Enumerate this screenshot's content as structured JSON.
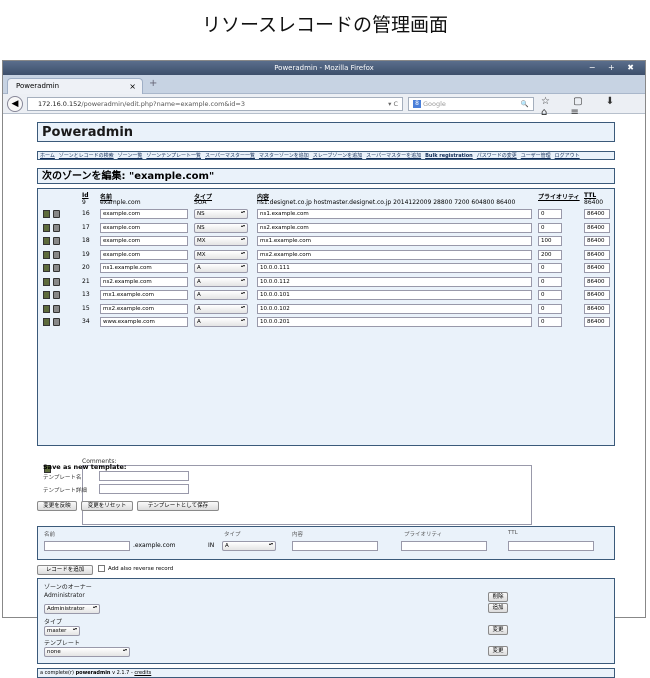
{
  "caption": "リソースレコードの管理画面",
  "window": {
    "title": "Poweradmin - Mozilla Firefox",
    "controls": "− + ✖",
    "tab_label": "Poweradmin",
    "tab_close": "×",
    "new_tab": "+"
  },
  "nav": {
    "url_prefix": "172.16.0.152",
    "url_path": "/poweradmin/edit.php?name=example.com&id=3",
    "url_end": "▾ C",
    "search_placeholder": "Google",
    "icons": "☆ ▢ ⬇ ⌂ ≡"
  },
  "page": {
    "title": "Poweradmin",
    "menu": [
      "ホーム",
      "ゾーンとレコードの検索",
      "ゾーン一覧",
      "ゾーンテンプレート一覧",
      "スーパーマスター一覧",
      "マスターゾーンを追加",
      "スレーブゾーンを追加",
      "スーパーマスターを追加",
      "Bulk registration",
      "パスワードの変更",
      "ユーザー管理",
      "ログアウト"
    ],
    "heading": "次のゾーンを編集: \"example.com\""
  },
  "table": {
    "headers": {
      "id": "Id",
      "name": "名前",
      "type": "タイプ",
      "content": "内容",
      "priority": "プライオリティ",
      "ttl": "TTL"
    },
    "soa": {
      "id": "9",
      "name": "example.com",
      "type": "SOA",
      "content": "ns1.designet.co.jp hostmaster.designet.co.jp 2014122009 28800 7200 604800 86400",
      "ttl": "86400"
    },
    "rows": [
      {
        "id": "16",
        "name": "example.com",
        "type": "NS",
        "content": "ns1.example.com",
        "prio": "0",
        "ttl": "86400"
      },
      {
        "id": "17",
        "name": "example.com",
        "type": "NS",
        "content": "ns2.example.com",
        "prio": "0",
        "ttl": "86400"
      },
      {
        "id": "18",
        "name": "example.com",
        "type": "MX",
        "content": "mx1.example.com",
        "prio": "100",
        "ttl": "86400"
      },
      {
        "id": "19",
        "name": "example.com",
        "type": "MX",
        "content": "mx2.example.com",
        "prio": "200",
        "ttl": "86400"
      },
      {
        "id": "20",
        "name": "ns1.example.com",
        "type": "A",
        "content": "10.0.0.111",
        "prio": "0",
        "ttl": "86400"
      },
      {
        "id": "21",
        "name": "ns2.example.com",
        "type": "A",
        "content": "10.0.0.112",
        "prio": "0",
        "ttl": "86400"
      },
      {
        "id": "13",
        "name": "mx1.example.com",
        "type": "A",
        "content": "10.0.0.101",
        "prio": "0",
        "ttl": "86400"
      },
      {
        "id": "15",
        "name": "mx2.example.com",
        "type": "A",
        "content": "10.0.0.102",
        "prio": "0",
        "ttl": "86400"
      },
      {
        "id": "34",
        "name": "www.example.com",
        "type": "A",
        "content": "10.0.0.201",
        "prio": "0",
        "ttl": "86400"
      }
    ],
    "comments_label": "Comments:"
  },
  "template": {
    "title": "Save as new template:",
    "name_label": "テンプレート名",
    "desc_label": "テンプレート詳細"
  },
  "buttons": {
    "commit": "変更を反映",
    "reset": "変更をリセット",
    "save_template": "テンプレートとして保存",
    "add_record": "レコードを追加",
    "delete": "削除",
    "add": "追加",
    "change_type": "変更",
    "change_template": "変更"
  },
  "add_record": {
    "name_label": "名前",
    "domain_suffix": ".example.com",
    "in_label": "IN",
    "type_label": "タイプ",
    "type_value": "A",
    "content_label": "内容",
    "priority_label": "プライオリティ",
    "ttl_label": "TTL",
    "reverse_label": "Add also reverse record"
  },
  "owner": {
    "title": "ゾーンのオーナー",
    "owner_name": "Administrator",
    "owner_select": "Administrator",
    "type_label": "タイプ",
    "type_value": "master",
    "template_label": "テンプレート",
    "template_value": "none"
  },
  "footer": {
    "prefix": "a complete(r)",
    "brand": "poweradmin",
    "version": "v 2.1.7 -",
    "credits": "credits"
  }
}
